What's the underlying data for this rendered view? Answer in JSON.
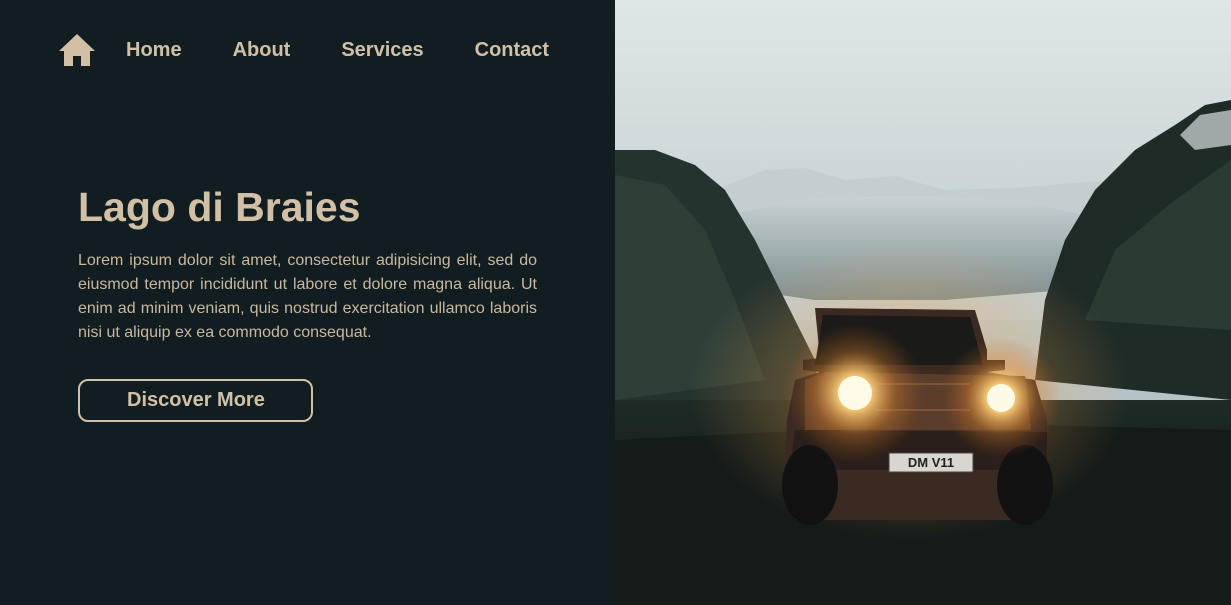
{
  "nav": {
    "home_icon": "home-icon",
    "links": [
      {
        "label": "Home"
      },
      {
        "label": "About"
      },
      {
        "label": "Services"
      },
      {
        "label": "Contact"
      }
    ]
  },
  "hero": {
    "title": "Lago di Braies",
    "text": "Lorem ipsum dolor sit amet, consectetur adipisicing elit, sed do eiusmod tempor incididunt ut labore et dolore magna aliqua. Ut enim ad minim veniam, quis nostrud exercitation ullamco laboris nisi ut aliquip ex ea commodo consequat.",
    "cta_label": "Discover More"
  },
  "photo": {
    "plate": "DM V11",
    "subject": "off-road-vehicle-with-headlights-in-mountain-valley"
  },
  "colors": {
    "background": "#111d21",
    "accent": "#d1c0a6"
  }
}
